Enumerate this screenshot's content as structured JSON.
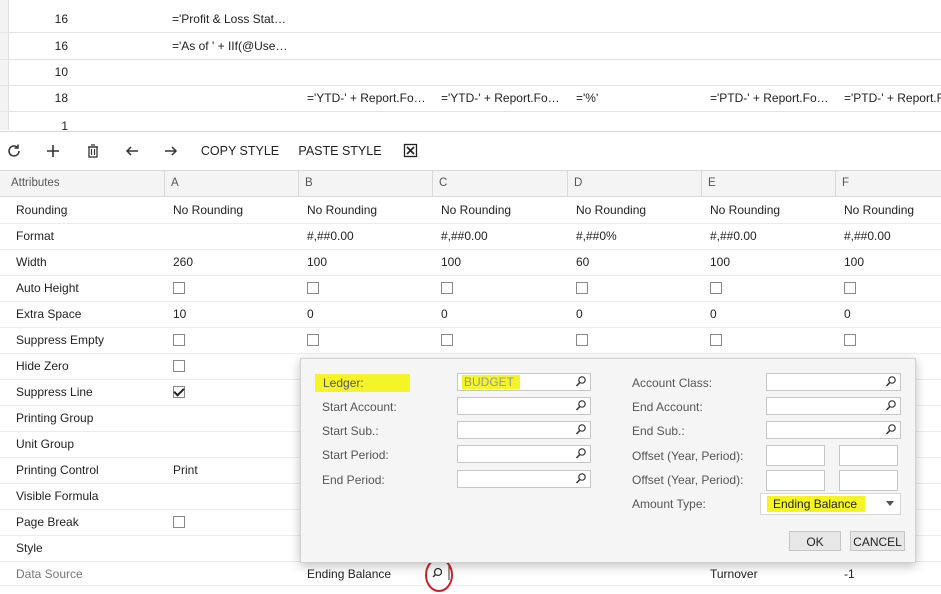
{
  "top_rows": [
    {
      "num": "16",
      "a": "='Profit & Loss Stat…",
      "b": "",
      "c": "",
      "d": "",
      "e": "",
      "f": ""
    },
    {
      "num": "16",
      "a": "='As of ' + IIf(@Use…",
      "b": "",
      "c": "",
      "d": "",
      "e": "",
      "f": ""
    },
    {
      "num": "10",
      "a": "",
      "b": "",
      "c": "",
      "d": "",
      "e": "",
      "f": ""
    },
    {
      "num": "18",
      "a": "",
      "b": "='YTD-' + Report.Fo…",
      "c": "='YTD-' + Report.Fo…",
      "d": "='%'",
      "e": "='PTD-' + Report.Fo…",
      "f": "='PTD-' + Report.F"
    },
    {
      "num": "1",
      "a": "",
      "b": "",
      "c": "",
      "d": "",
      "e": "",
      "f": ""
    }
  ],
  "toolbar": {
    "refresh_icon": "refresh-icon",
    "add_icon": "plus-icon",
    "delete_icon": "trash-icon",
    "back_icon": "arrow-left-icon",
    "forward_icon": "arrow-right-icon",
    "copy_style": "COPY STYLE",
    "paste_style": "PASTE STYLE",
    "clear_icon": "clear-x-icon"
  },
  "grid": {
    "headers": [
      "Attributes",
      "A",
      "B",
      "C",
      "D",
      "E",
      "F"
    ],
    "rows": [
      {
        "label": "Rounding",
        "vals": [
          "No Rounding",
          "No Rounding",
          "No Rounding",
          "No Rounding",
          "No Rounding",
          "No Rounding"
        ]
      },
      {
        "label": "Format",
        "vals": [
          "",
          "#,##0.00",
          "#,##0.00",
          "#,##0%",
          "#,##0.00",
          "#,##0.00"
        ]
      },
      {
        "label": "Width",
        "vals": [
          "260",
          "100",
          "100",
          "60",
          "100",
          "100"
        ]
      },
      {
        "label": "Auto Height",
        "checks": [
          false,
          false,
          false,
          false,
          false,
          false
        ]
      },
      {
        "label": "Extra Space",
        "vals": [
          "10",
          "0",
          "0",
          "0",
          "0",
          "0"
        ]
      },
      {
        "label": "Suppress Empty",
        "checks": [
          false,
          false,
          false,
          false,
          false,
          false
        ]
      },
      {
        "label": "Hide Zero",
        "checks": [
          false
        ]
      },
      {
        "label": "Suppress Line",
        "checks": [
          true
        ]
      },
      {
        "label": "Printing Group",
        "vals": [
          ""
        ]
      },
      {
        "label": "Unit Group",
        "vals": [
          ""
        ]
      },
      {
        "label": "Printing Control",
        "vals": [
          "Print"
        ]
      },
      {
        "label": "Visible Formula",
        "vals": [
          ""
        ]
      },
      {
        "label": "Page Break",
        "checks": [
          false
        ]
      },
      {
        "label": "Style",
        "vals": [
          ""
        ]
      },
      {
        "label": "Data Source",
        "vals": [
          "",
          "Ending Balance",
          "",
          "",
          "Turnover",
          "-1"
        ]
      }
    ]
  },
  "popup": {
    "ledger_label": "Ledger:",
    "ledger_value": "BUDGET",
    "start_account_label": "Start Account:",
    "start_sub_label": "Start Sub.:",
    "start_period_label": "Start Period:",
    "end_period_label": "End Period:",
    "account_class_label": "Account Class:",
    "end_account_label": "End Account:",
    "end_sub_label": "End Sub.:",
    "offset1_label": "Offset (Year, Period):",
    "offset2_label": "Offset (Year, Period):",
    "amount_type_label": "Amount Type:",
    "amount_type_value": "Ending Balance",
    "ok_label": "OK",
    "cancel_label": "CANCEL"
  },
  "colors": {
    "highlight": "#f4f426",
    "annotation": "#d4202a"
  }
}
